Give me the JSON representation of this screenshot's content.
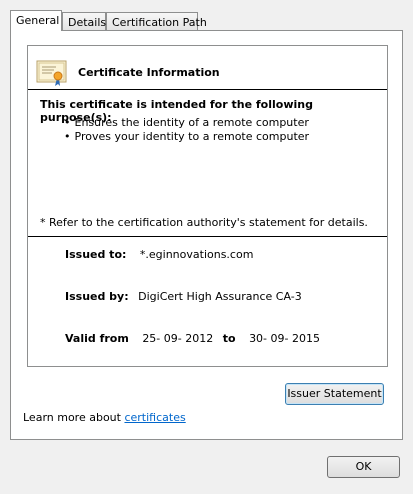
{
  "tabs": [
    {
      "label": "General",
      "active": true
    },
    {
      "label": "Details",
      "active": false
    },
    {
      "label": "Certification Path",
      "active": false
    }
  ],
  "certificate": {
    "icon": "certificate-icon",
    "title": "Certificate Information",
    "purpose_heading": "This certificate is intended for the following purpose(s):",
    "purposes": [
      "Ensures the identity of a remote computer",
      "Proves your identity to a remote computer"
    ],
    "note": "* Refer to the certification authority's statement for details.",
    "issued_to_label": "Issued to:",
    "issued_to": "*.eginnovations.com",
    "issued_by_label": "Issued by:",
    "issued_by": "DigiCert High Assurance CA-3",
    "valid_from_label": "Valid from",
    "valid_from": "25- 09- 2012",
    "valid_to_label": "to",
    "valid_to": "30- 09- 2015"
  },
  "buttons": {
    "issuer_statement": "Issuer Statement",
    "ok": "OK"
  },
  "learn_more": {
    "prefix": "Learn more about ",
    "link": "certificates"
  }
}
